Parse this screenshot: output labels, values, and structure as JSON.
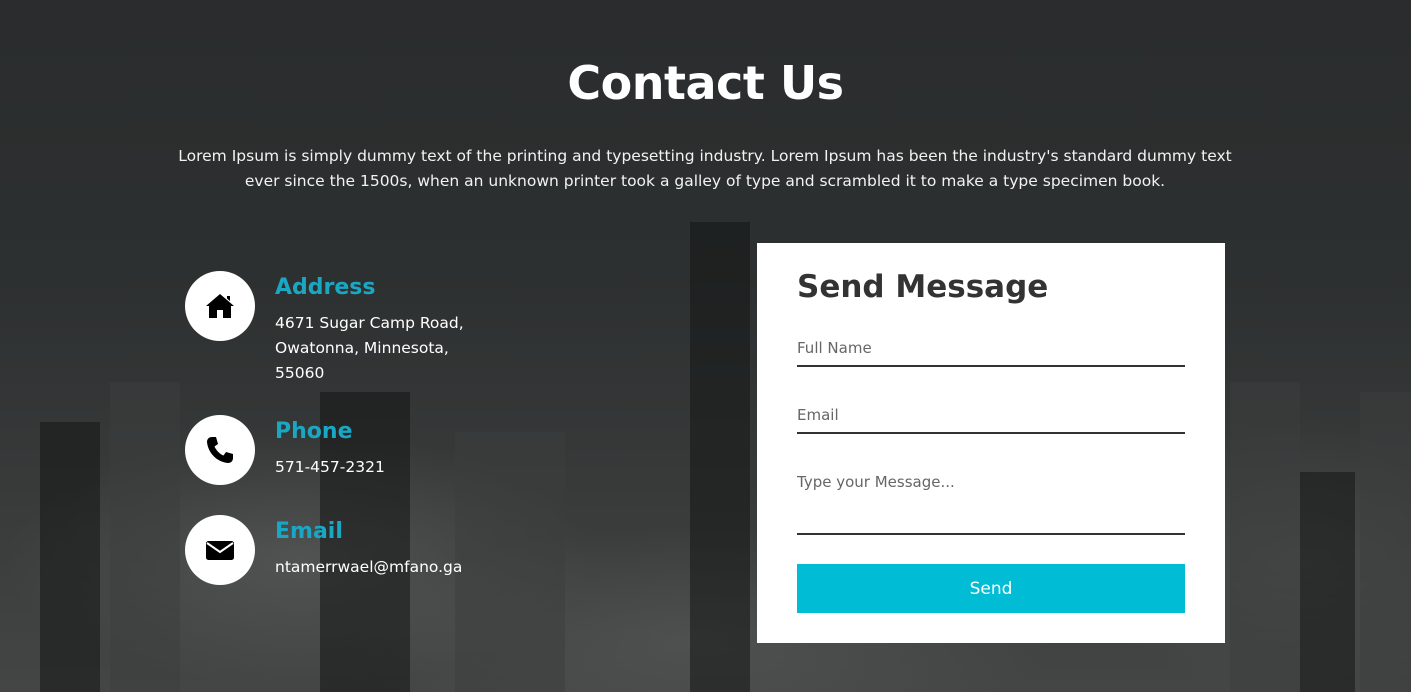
{
  "page": {
    "title": "Contact Us",
    "description": "Lorem Ipsum is simply dummy text of the printing and typesetting industry. Lorem Ipsum has been the industry's standard dummy text ever since the 1500s, when an unknown printer took a galley of type and scrambled it to make a type specimen book."
  },
  "contact": {
    "address": {
      "icon": "home-icon",
      "label": "Address",
      "line1": "4671 Sugar Camp Road,",
      "line2": "Owatonna, Minnesota,",
      "line3": "55060"
    },
    "phone": {
      "icon": "phone-icon",
      "label": "Phone",
      "value": "571-457-2321"
    },
    "email": {
      "icon": "envelope-icon",
      "label": "Email",
      "value": "ntamerrwael@mfano.ga"
    }
  },
  "form": {
    "title": "Send Message",
    "full_name_placeholder": "Full Name",
    "email_placeholder": "Email",
    "message_placeholder": "Type your Message...",
    "send_label": "Send"
  },
  "colors": {
    "accent": "#1aa7c4",
    "button": "#00bcd4",
    "background": "#2b2d2e"
  }
}
